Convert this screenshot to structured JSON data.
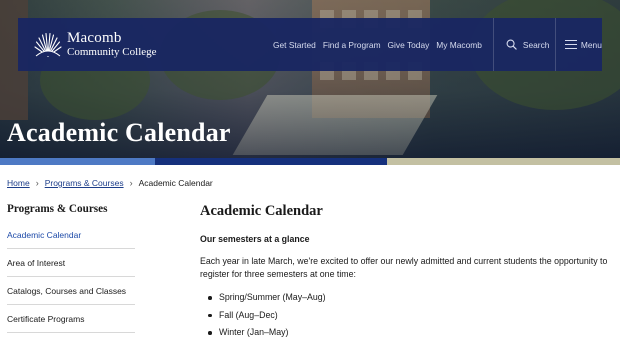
{
  "logo": {
    "name": "Macomb",
    "sub": "Community College"
  },
  "nav": {
    "links": [
      "Get Started",
      "Find a Program",
      "Give Today",
      "My Macomb"
    ],
    "search_label": "Search",
    "menu_label": "Menu"
  },
  "hero": {
    "title": "Academic Calendar"
  },
  "breadcrumb": {
    "home": "Home",
    "section": "Programs & Courses",
    "current": "Academic Calendar"
  },
  "sidebar": {
    "title": "Programs & Courses",
    "items": [
      "Academic Calendar",
      "Area of Interest",
      "Catalogs, Courses and Classes",
      "Certificate Programs"
    ]
  },
  "main": {
    "title": "Academic Calendar",
    "subheading": "Our semesters at a glance",
    "paragraph": "Each year in late March, we're excited to offer our newly admitted and current students the opportunity to register for three semesters at one time:",
    "semesters": [
      "Spring/Summer (May–Aug)",
      "Fall (Aug–Dec)",
      "Winter (Jan–May)"
    ]
  },
  "colors": {
    "navbar": "#192662",
    "stripe_light_blue": "#4d79c4",
    "stripe_dark_blue": "#15307c",
    "stripe_tan": "#c3c0a2",
    "link": "#1d3e8a",
    "active_link": "#1d4aa8"
  },
  "icons": {
    "logo": "sunburst-logo-icon",
    "search": "search-icon",
    "menu": "hamburger-menu-icon",
    "breadcrumb_separator": "chevron-right-icon"
  }
}
